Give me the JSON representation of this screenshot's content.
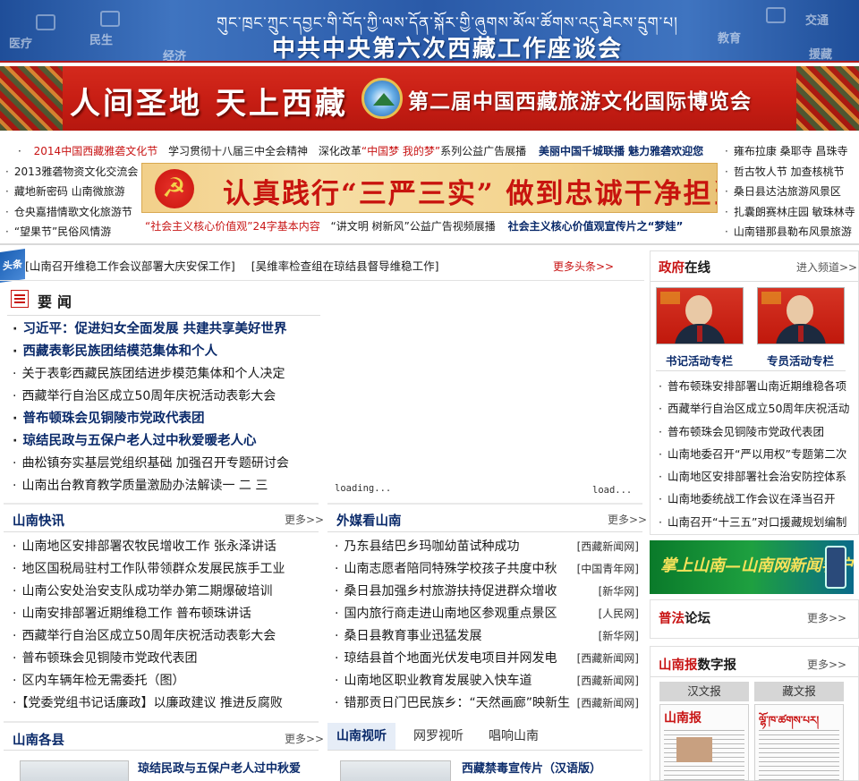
{
  "banner_top": {
    "tibetan": "གུང་ཁྲང་ཀྲུང་དབྱང་གི་བོད་ཀྱི་ལས་དོན་སྐོར་གྱི་ཞུགས་མོལ་ཚོགས་འདུ་ཐེངས་དྲུག་པ།",
    "title": "中共中央第六次西藏工作座谈会",
    "deco_left": [
      "医疗",
      "民生",
      "经济"
    ],
    "deco_right": [
      "交通",
      "教育",
      "援藏"
    ]
  },
  "banner_expo": {
    "slogan": "人间圣地  天上西藏",
    "expo": "第二届中国西藏旅游文化国际博览会"
  },
  "promo": {
    "top": [
      {
        "text": "2014中国西藏雅砻文化节",
        "style": "red"
      },
      {
        "text": "学习贯彻十八届三中全会精神",
        "style": "plain"
      },
      {
        "text": "深化改革",
        "style": "plain"
      },
      {
        "text": "“中国梦 我的梦”",
        "style": "red"
      },
      {
        "text": "系列公益广告展播",
        "style": "plain"
      },
      {
        "text": "美丽中国千城联播 魅力雅砻欢迎您",
        "style": "boldnavy"
      }
    ],
    "left": [
      "2013雅砻物资文化交流会",
      "藏地新密码 山南微旅游",
      "仓央嘉措情歌文化旅游节",
      "“望果节”民俗风情游"
    ],
    "right": [
      "雍布拉康 桑耶寺 昌珠寺",
      "哲古牧人节 加查核桃节",
      "桑日县达沽旅游风景区",
      "扎囊朗赛林庄园 敏珠林寺",
      "山南错那县勒布风景旅游"
    ],
    "banner_text": "认真践行“三严三实” 做到忠诚干净担当",
    "bottom": [
      {
        "text": "“社会主义核心价值观”",
        "style": "red"
      },
      {
        "text": "24字基本内容",
        "style": "red"
      },
      {
        "text": "“讲文明 树新风”公益广告视频展播",
        "style": "plain"
      },
      {
        "text": "社会主义核心价值观宣传片之“梦娃”",
        "style": "boldnavy"
      }
    ]
  },
  "headline": {
    "tag": "头条",
    "items": [
      "[山南召开维稳工作会议部署大庆安保工作]",
      "[吴维率检查组在琼结县督导维稳工作]"
    ],
    "more": "更多头条>>"
  },
  "important_news": {
    "title": "要闻",
    "items": [
      {
        "text": "习近平：促进妇女全面发展 共建共享美好世界",
        "strong": true
      },
      {
        "text": "西藏表彰民族团结模范集体和个人",
        "strong": true
      },
      {
        "text": "关于表彰西藏民族团结进步模范集体和个人决定",
        "strong": false
      },
      {
        "text": "西藏举行自治区成立50周年庆祝活动表彰大会",
        "strong": false
      },
      {
        "text": "普布顿珠会见铜陵市党政代表团",
        "strong": true
      },
      {
        "text": "琼结民政与五保户老人过中秋爱暖老人心",
        "strong": true
      },
      {
        "text": "曲松镇夯实基层党组织基础 加强召开专题研讨会",
        "strong": false
      },
      {
        "text": "山南出台教育教学质量激励办法解读一 二 三",
        "strong": false
      }
    ]
  },
  "loading": [
    "loading...",
    "load..."
  ],
  "shannan_news": {
    "title": "山南快讯",
    "more": "更多>>",
    "items": [
      "山南地区安排部署农牧民增收工作 张永泽讲话",
      "地区国税局驻村工作队带领群众发展民族手工业",
      "山南公安处治安支队成功举办第二期爆破培训",
      "山南安排部署近期维稳工作 普布顿珠讲话",
      "西藏举行自治区成立50周年庆祝活动表彰大会",
      "普布顿珠会见铜陵市党政代表团",
      "区内车辆年检无需委托（图）",
      "【党委党组书记话廉政】以廉政建议 推进反腐败"
    ]
  },
  "foreign_media": {
    "title": "外媒看山南",
    "more": "更多>>",
    "items": [
      {
        "text": "乃东县结巴乡玛咖幼苗试种成功",
        "source": "[西藏新闻网]"
      },
      {
        "text": "山南志愿者陪同特殊学校孩子共度中秋",
        "source": "[中国青年网]"
      },
      {
        "text": "桑日县加强乡村旅游扶持促进群众增收",
        "source": "[新华网]"
      },
      {
        "text": "国内旅行商走进山南地区参观重点景区",
        "source": "[人民网]"
      },
      {
        "text": "桑日县教育事业迅猛发展",
        "source": "[新华网]"
      },
      {
        "text": "琼结县首个地面光伏发电项目并网发电",
        "source": "[西藏新闻网]"
      },
      {
        "text": "山南地区职业教育发展驶入快车道",
        "source": "[西藏新闻网]"
      },
      {
        "text": "错那贡日门巴民族乡：“天然画廊”映新生",
        "source": "[西藏新闻网]"
      }
    ]
  },
  "gov_online": {
    "title_red": "政府",
    "title_rest": "在线",
    "more": "进入频道>>",
    "columns": [
      "书记活动专栏",
      "专员活动专栏"
    ],
    "items": [
      "普布顿珠安排部署山南近期维稳各项",
      "西藏举行自治区成立50周年庆祝活动",
      "普布顿珠会见铜陵市党政代表团",
      "山南地委召开“严以用权”专题第二次",
      "山南地区安排部署社会治安防控体系",
      "山南地委统战工作会议在泽当召开",
      "山南召开“十三五”对口援藏规划编制"
    ]
  },
  "mobile_banner": {
    "text": "掌上山南—山南网新闻客户端"
  },
  "law_forum": {
    "title_red": "普法",
    "title_rest": "论坛",
    "more": "更多>>"
  },
  "digital_paper": {
    "title_red": "山南报",
    "title_rest": "数字报",
    "more": "更多>>",
    "tabs": [
      "汉文报",
      "藏文报"
    ],
    "mast_han": "山南报",
    "mast_tib": "ལྷོ་ཁ་ཚགས་པར།"
  },
  "counties": {
    "title": "山南各县",
    "more": "更多>>",
    "item": "琼结民政与五保户老人过中秋爱"
  },
  "video": {
    "tabs": [
      "山南视听",
      "网罗视听",
      "唱响山南"
    ],
    "item": "西藏禁毒宣传片（汉语版）"
  }
}
